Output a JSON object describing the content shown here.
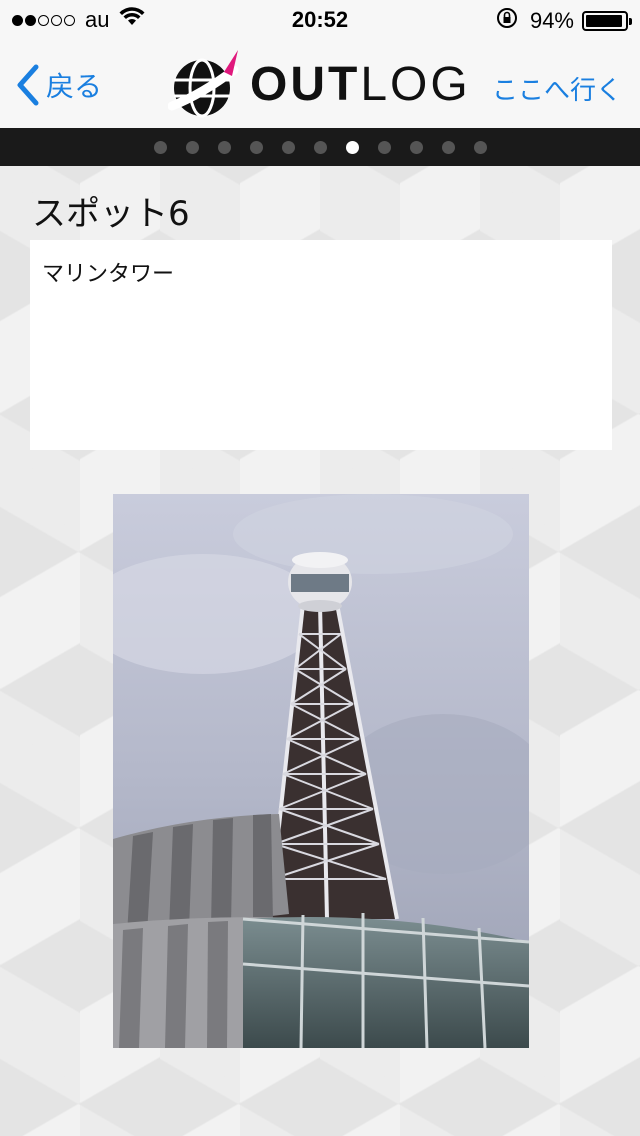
{
  "status_bar": {
    "signal_filled": 2,
    "signal_total": 5,
    "carrier": "au",
    "time": "20:52",
    "battery": "94%",
    "battery_level": 0.94
  },
  "nav": {
    "back_label": "戻る",
    "logo_text_bold": "OUT",
    "logo_text_light": "LOG",
    "goto_label": "ここへ行く"
  },
  "pager": {
    "total": 11,
    "active_index": 6
  },
  "spot": {
    "title": "スポット6",
    "description": "マリンタワー"
  },
  "colors": {
    "accent": "#1a7fe0",
    "pager_bg": "#1a1a1a",
    "logo_pink": "#e0197d"
  },
  "icons": [
    "wifi-icon",
    "rotation-lock-icon",
    "battery-icon",
    "chevron-left-icon",
    "globe-logo-icon"
  ]
}
